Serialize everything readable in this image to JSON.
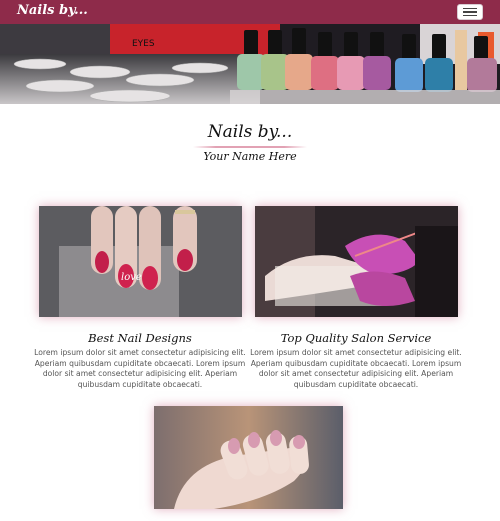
{
  "navbar": {
    "brand": "Nails by...",
    "toggler_icon": "hamburger-icon",
    "color": "#8e2b4a"
  },
  "hero": {
    "description": "Rows of nail polish bottles on a salon counter",
    "sign_text": "EYES"
  },
  "header": {
    "title": "Nails by...",
    "subtitle": "Your Name Here",
    "accent": "#e2a2b4"
  },
  "cards": [
    {
      "title": "Best Nail Designs",
      "text": "Lorem ipsum dolor sit amet consectetur adipisicing elit. Aperiam quibusdam cupiditate obcaecati. Lorem ipsum dolor sit amet consectetur adipisicing elit. Aperiam quibusdam cupiditate obcaecati.",
      "nail_text": "love"
    },
    {
      "title": "Top Quality Salon Service",
      "text": "Lorem ipsum dolor sit amet consectetur adipisicing elit. Aperiam quibusdam cupiditate obcaecati. Lorem ipsum dolor sit amet consectetur adipisicing elit. Aperiam quibusdam cupiditate obcaecati."
    },
    {
      "title": "",
      "text": ""
    }
  ]
}
